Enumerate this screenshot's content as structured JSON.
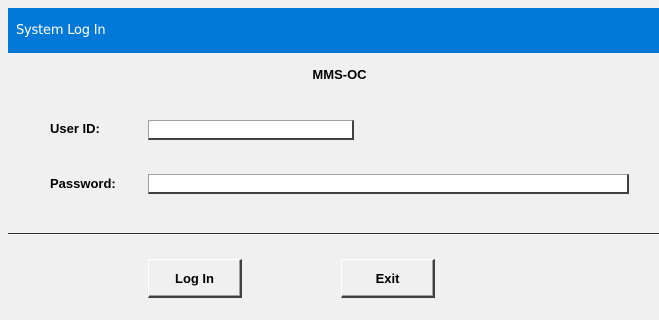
{
  "window": {
    "title": "System  Log In"
  },
  "form": {
    "app_name": "MMS-OC",
    "user_id_label": "User ID:",
    "user_id_value": "",
    "password_label": "Password:",
    "password_value": ""
  },
  "buttons": {
    "login_label": "Log In",
    "exit_label": "Exit"
  },
  "colors": {
    "titlebar": "#0078d7",
    "background": "#f0f0f0"
  }
}
